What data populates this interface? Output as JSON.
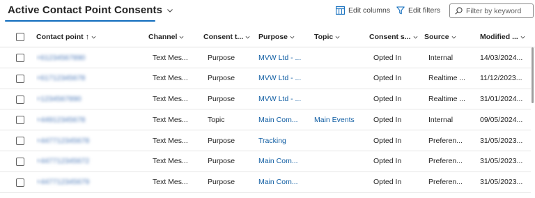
{
  "view": {
    "title": "Active Contact Point Consents"
  },
  "commands": {
    "edit_columns": "Edit columns",
    "edit_filters": "Edit filters"
  },
  "search": {
    "placeholder": "Filter by keyword"
  },
  "columns": [
    {
      "label": "Contact point",
      "sort": "↑"
    },
    {
      "label": "Channel"
    },
    {
      "label": "Consent t..."
    },
    {
      "label": "Purpose"
    },
    {
      "label": "Topic"
    },
    {
      "label": "Consent s..."
    },
    {
      "label": "Source"
    },
    {
      "label": "Modified ..."
    }
  ],
  "rows": [
    {
      "contact_point": "+61234567890",
      "channel": "Text Mes...",
      "consent_type": "Purpose",
      "purpose": "MVW Ltd - ...",
      "topic": "",
      "consent_status": "Opted In",
      "source": "Internal",
      "modified": "14/03/2024..."
    },
    {
      "contact_point": "+61712345678",
      "channel": "Text Mes...",
      "consent_type": "Purpose",
      "purpose": "MVW Ltd - ...",
      "topic": "",
      "consent_status": "Opted In",
      "source": "Realtime ...",
      "modified": "11/12/2023..."
    },
    {
      "contact_point": "+1234567890",
      "channel": "Text Mes...",
      "consent_type": "Purpose",
      "purpose": "MVW Ltd - ...",
      "topic": "",
      "consent_status": "Opted In",
      "source": "Realtime ...",
      "modified": "31/01/2024..."
    },
    {
      "contact_point": "+44912345678",
      "channel": "Text Mes...",
      "consent_type": "Topic",
      "purpose": "Main Com...",
      "topic": "Main Events",
      "consent_status": "Opted In",
      "source": "Internal",
      "modified": "09/05/2024..."
    },
    {
      "contact_point": "+447712345678",
      "channel": "Text Mes...",
      "consent_type": "Purpose",
      "purpose": "Tracking",
      "topic": "",
      "consent_status": "Opted In",
      "source": "Preferen...",
      "modified": "31/05/2023..."
    },
    {
      "contact_point": "+447712345672",
      "channel": "Text Mes...",
      "consent_type": "Purpose",
      "purpose": "Main Com...",
      "topic": "",
      "consent_status": "Opted In",
      "source": "Preferen...",
      "modified": "31/05/2023..."
    },
    {
      "contact_point": "+447712345679",
      "channel": "Text Mes...",
      "consent_type": "Purpose",
      "purpose": "Main Com...",
      "topic": "",
      "consent_status": "Opted In",
      "source": "Preferen...",
      "modified": "31/05/2023..."
    }
  ],
  "colors": {
    "accent": "#0f6cbd",
    "link": "#115ea3",
    "text": "#242424"
  }
}
